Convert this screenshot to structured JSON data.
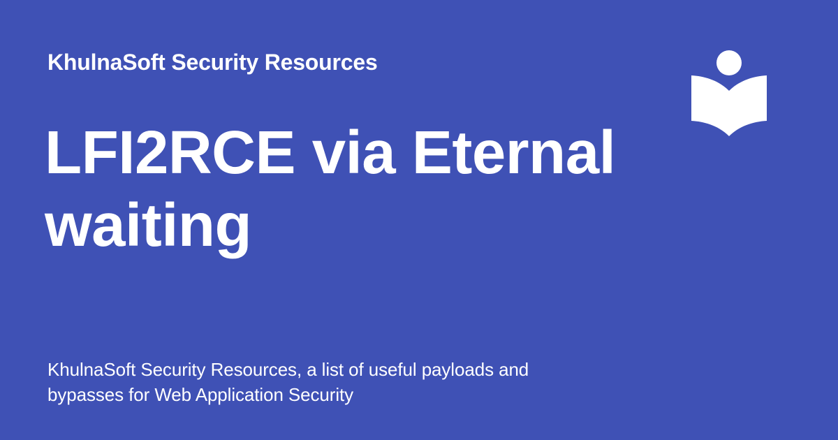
{
  "site": {
    "name": "KhulnaSoft Security Resources"
  },
  "page": {
    "title": "LFI2RCE via Eternal waiting",
    "description": "KhulnaSoft Security Resources, a list of useful payloads and bypasses for Web Application Security"
  },
  "logo": {
    "icon": "reader-book-icon",
    "color": "#ffffff"
  },
  "theme": {
    "background": "#3f51b5",
    "text": "#ffffff"
  }
}
